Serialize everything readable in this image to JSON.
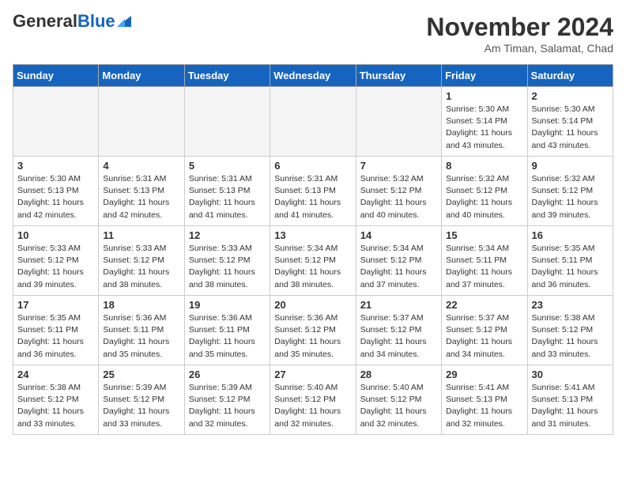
{
  "header": {
    "logo_general": "General",
    "logo_blue": "Blue",
    "month_title": "November 2024",
    "location": "Am Timan, Salamat, Chad"
  },
  "weekdays": [
    "Sunday",
    "Monday",
    "Tuesday",
    "Wednesday",
    "Thursday",
    "Friday",
    "Saturday"
  ],
  "weeks": [
    [
      {
        "day": "",
        "info": "",
        "empty": true
      },
      {
        "day": "",
        "info": "",
        "empty": true
      },
      {
        "day": "",
        "info": "",
        "empty": true
      },
      {
        "day": "",
        "info": "",
        "empty": true
      },
      {
        "day": "",
        "info": "",
        "empty": true
      },
      {
        "day": "1",
        "info": "Sunrise: 5:30 AM\nSunset: 5:14 PM\nDaylight: 11 hours\nand 43 minutes.",
        "empty": false
      },
      {
        "day": "2",
        "info": "Sunrise: 5:30 AM\nSunset: 5:14 PM\nDaylight: 11 hours\nand 43 minutes.",
        "empty": false
      }
    ],
    [
      {
        "day": "3",
        "info": "Sunrise: 5:30 AM\nSunset: 5:13 PM\nDaylight: 11 hours\nand 42 minutes.",
        "empty": false
      },
      {
        "day": "4",
        "info": "Sunrise: 5:31 AM\nSunset: 5:13 PM\nDaylight: 11 hours\nand 42 minutes.",
        "empty": false
      },
      {
        "day": "5",
        "info": "Sunrise: 5:31 AM\nSunset: 5:13 PM\nDaylight: 11 hours\nand 41 minutes.",
        "empty": false
      },
      {
        "day": "6",
        "info": "Sunrise: 5:31 AM\nSunset: 5:13 PM\nDaylight: 11 hours\nand 41 minutes.",
        "empty": false
      },
      {
        "day": "7",
        "info": "Sunrise: 5:32 AM\nSunset: 5:12 PM\nDaylight: 11 hours\nand 40 minutes.",
        "empty": false
      },
      {
        "day": "8",
        "info": "Sunrise: 5:32 AM\nSunset: 5:12 PM\nDaylight: 11 hours\nand 40 minutes.",
        "empty": false
      },
      {
        "day": "9",
        "info": "Sunrise: 5:32 AM\nSunset: 5:12 PM\nDaylight: 11 hours\nand 39 minutes.",
        "empty": false
      }
    ],
    [
      {
        "day": "10",
        "info": "Sunrise: 5:33 AM\nSunset: 5:12 PM\nDaylight: 11 hours\nand 39 minutes.",
        "empty": false
      },
      {
        "day": "11",
        "info": "Sunrise: 5:33 AM\nSunset: 5:12 PM\nDaylight: 11 hours\nand 38 minutes.",
        "empty": false
      },
      {
        "day": "12",
        "info": "Sunrise: 5:33 AM\nSunset: 5:12 PM\nDaylight: 11 hours\nand 38 minutes.",
        "empty": false
      },
      {
        "day": "13",
        "info": "Sunrise: 5:34 AM\nSunset: 5:12 PM\nDaylight: 11 hours\nand 38 minutes.",
        "empty": false
      },
      {
        "day": "14",
        "info": "Sunrise: 5:34 AM\nSunset: 5:12 PM\nDaylight: 11 hours\nand 37 minutes.",
        "empty": false
      },
      {
        "day": "15",
        "info": "Sunrise: 5:34 AM\nSunset: 5:11 PM\nDaylight: 11 hours\nand 37 minutes.",
        "empty": false
      },
      {
        "day": "16",
        "info": "Sunrise: 5:35 AM\nSunset: 5:11 PM\nDaylight: 11 hours\nand 36 minutes.",
        "empty": false
      }
    ],
    [
      {
        "day": "17",
        "info": "Sunrise: 5:35 AM\nSunset: 5:11 PM\nDaylight: 11 hours\nand 36 minutes.",
        "empty": false
      },
      {
        "day": "18",
        "info": "Sunrise: 5:36 AM\nSunset: 5:11 PM\nDaylight: 11 hours\nand 35 minutes.",
        "empty": false
      },
      {
        "day": "19",
        "info": "Sunrise: 5:36 AM\nSunset: 5:11 PM\nDaylight: 11 hours\nand 35 minutes.",
        "empty": false
      },
      {
        "day": "20",
        "info": "Sunrise: 5:36 AM\nSunset: 5:12 PM\nDaylight: 11 hours\nand 35 minutes.",
        "empty": false
      },
      {
        "day": "21",
        "info": "Sunrise: 5:37 AM\nSunset: 5:12 PM\nDaylight: 11 hours\nand 34 minutes.",
        "empty": false
      },
      {
        "day": "22",
        "info": "Sunrise: 5:37 AM\nSunset: 5:12 PM\nDaylight: 11 hours\nand 34 minutes.",
        "empty": false
      },
      {
        "day": "23",
        "info": "Sunrise: 5:38 AM\nSunset: 5:12 PM\nDaylight: 11 hours\nand 33 minutes.",
        "empty": false
      }
    ],
    [
      {
        "day": "24",
        "info": "Sunrise: 5:38 AM\nSunset: 5:12 PM\nDaylight: 11 hours\nand 33 minutes.",
        "empty": false
      },
      {
        "day": "25",
        "info": "Sunrise: 5:39 AM\nSunset: 5:12 PM\nDaylight: 11 hours\nand 33 minutes.",
        "empty": false
      },
      {
        "day": "26",
        "info": "Sunrise: 5:39 AM\nSunset: 5:12 PM\nDaylight: 11 hours\nand 32 minutes.",
        "empty": false
      },
      {
        "day": "27",
        "info": "Sunrise: 5:40 AM\nSunset: 5:12 PM\nDaylight: 11 hours\nand 32 minutes.",
        "empty": false
      },
      {
        "day": "28",
        "info": "Sunrise: 5:40 AM\nSunset: 5:12 PM\nDaylight: 11 hours\nand 32 minutes.",
        "empty": false
      },
      {
        "day": "29",
        "info": "Sunrise: 5:41 AM\nSunset: 5:13 PM\nDaylight: 11 hours\nand 32 minutes.",
        "empty": false
      },
      {
        "day": "30",
        "info": "Sunrise: 5:41 AM\nSunset: 5:13 PM\nDaylight: 11 hours\nand 31 minutes.",
        "empty": false
      }
    ]
  ]
}
